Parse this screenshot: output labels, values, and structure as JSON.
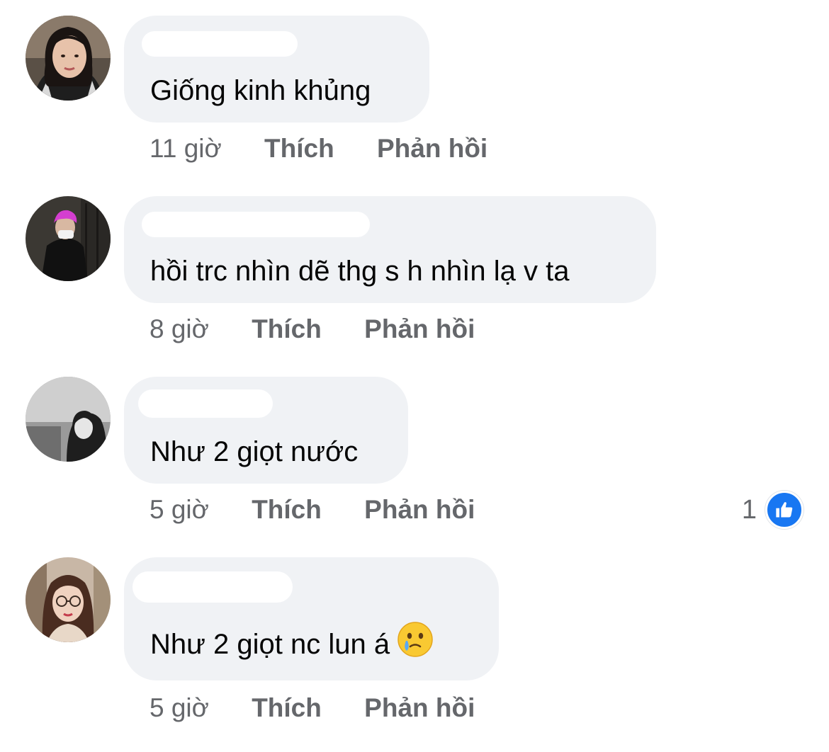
{
  "colors": {
    "bubble": "#f0f2f5",
    "meta_text": "#65676b",
    "text": "#050505",
    "like_blue": "#1877f2"
  },
  "comments": [
    {
      "text": "Giống kinh khủng",
      "time": "11 giờ",
      "like_label": "Thích",
      "reply_label": "Phản hồi"
    },
    {
      "text": "hồi trc nhìn dẽ thg s h nhìn lạ v ta",
      "time": "8 giờ",
      "like_label": "Thích",
      "reply_label": "Phản hồi"
    },
    {
      "text": "Như 2 giọt nước",
      "time": "5 giờ",
      "like_label": "Thích",
      "reply_label": "Phản hồi",
      "reaction_count": "1",
      "reaction_icon": "like-thumb-icon"
    },
    {
      "text": "Như 2 giọt nc lun á",
      "emoji": "face-holding-back-tears-emoji",
      "time": "5 giờ",
      "like_label": "Thích",
      "reply_label": "Phản hồi"
    }
  ]
}
